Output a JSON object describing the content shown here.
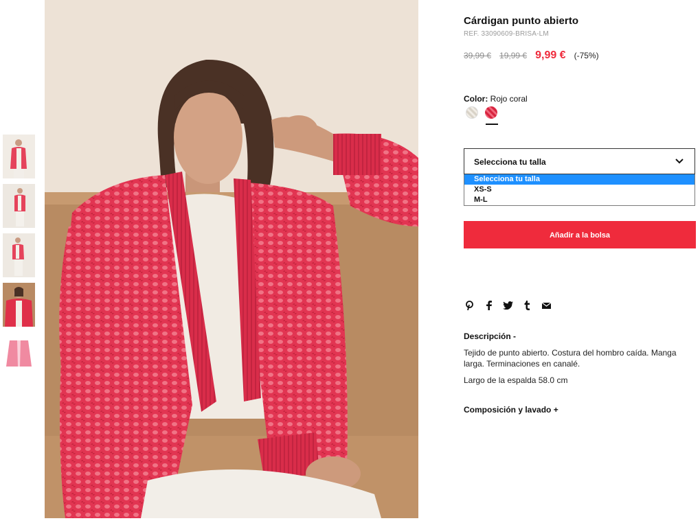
{
  "product": {
    "title": "Cárdigan punto abierto",
    "ref": "REF. 33090609-BRISA-LM",
    "prices": {
      "original": "39,99 €",
      "previous": "19,99 €",
      "current": "9,99 €",
      "discount": "(-75%)"
    },
    "colors": {
      "label": "Color:",
      "selected": "Rojo coral",
      "swatches": [
        {
          "name": "crudo",
          "hex": "#e6e1d8",
          "selected": false
        },
        {
          "name": "rojo-coral",
          "hex": "#e8344f",
          "selected": true
        }
      ]
    },
    "size_select": {
      "value": "Selecciona tu talla",
      "options": [
        "Selecciona tu talla",
        "XS-S",
        "M-L"
      ]
    },
    "add_button": "Añadir a la bolsa",
    "share_icons": [
      "pinterest-icon",
      "facebook-icon",
      "twitter-icon",
      "tumblr-icon",
      "mail-icon"
    ],
    "description": {
      "heading": "Descripción  -",
      "text": "Tejido de punto abierto. Costura del hombro caída. Manga larga. Terminaciones en canalé.",
      "length": "Largo de la espalda 58.0 cm"
    },
    "composition_heading": "Composición y lavado  +"
  },
  "theme": {
    "accent": "#ef2b3c",
    "select_highlight": "#1e90ff"
  }
}
